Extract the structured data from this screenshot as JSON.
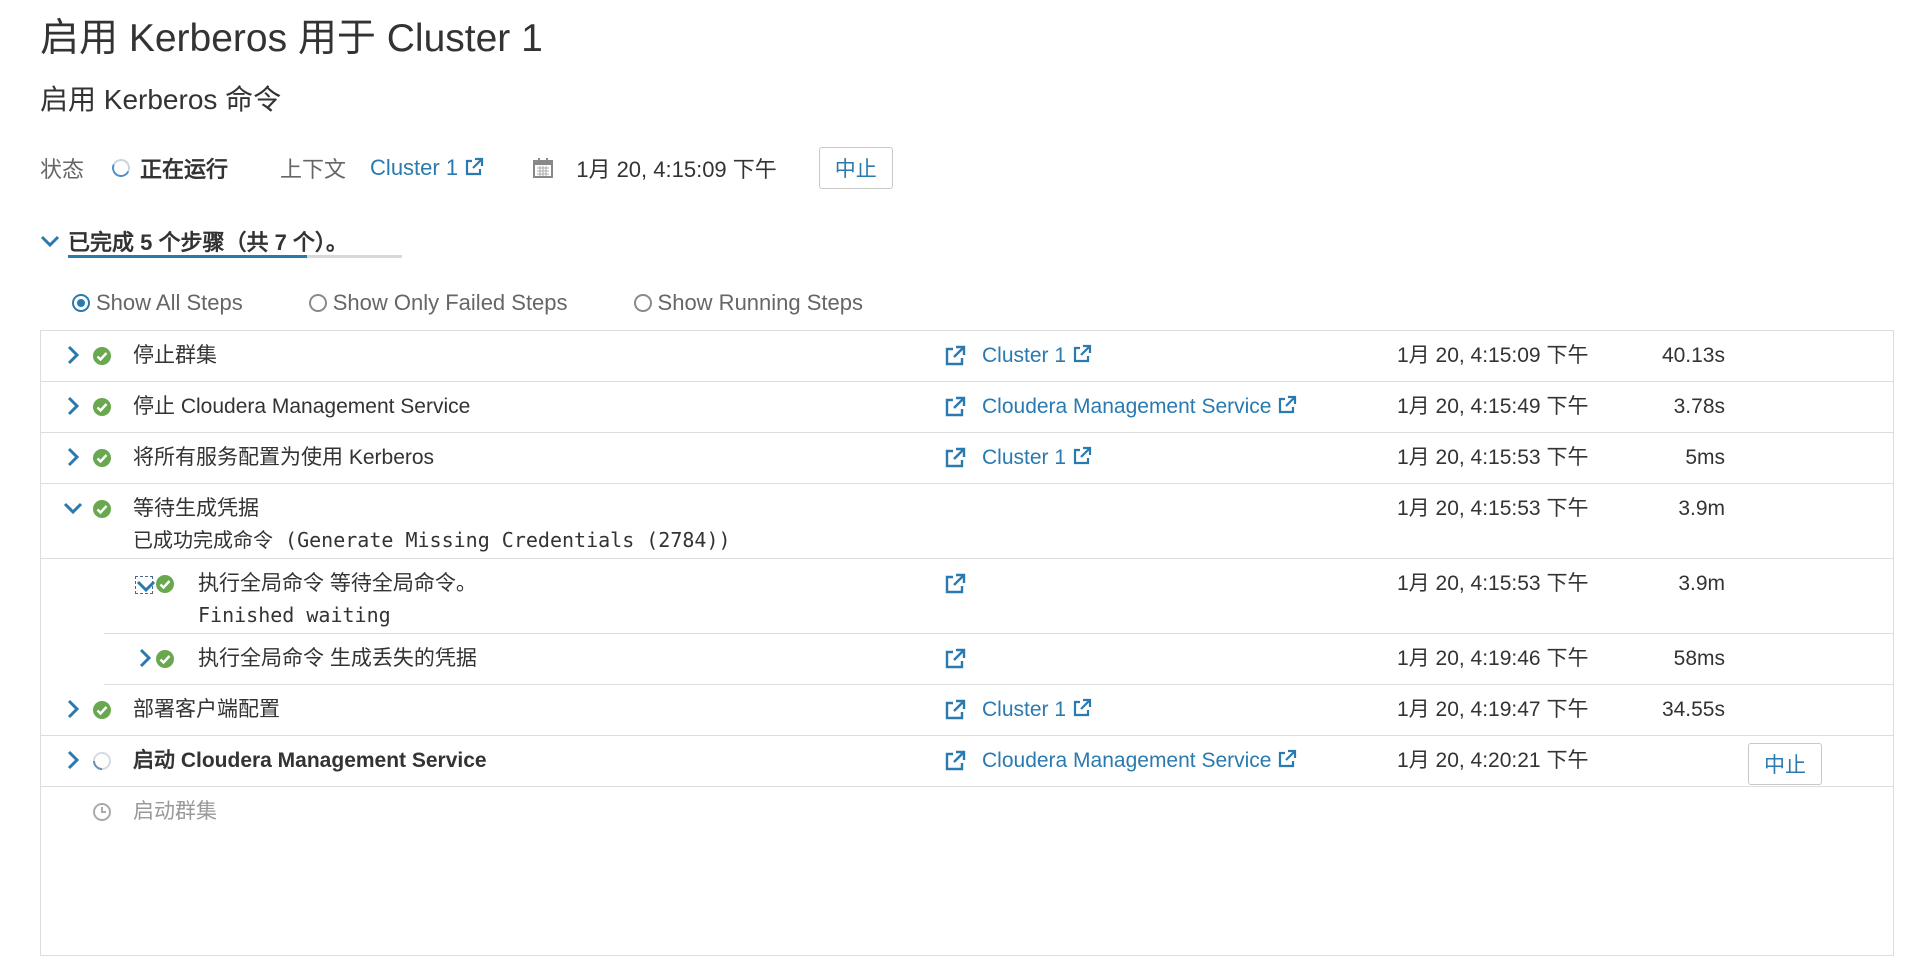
{
  "page": {
    "title": "启用 Kerberos 用于 Cluster 1",
    "command_title": "启用 Kerberos 命令"
  },
  "status_bar": {
    "status_label": "状态",
    "status_value": "正在运行",
    "context_label": "上下文",
    "context_link": "Cluster 1",
    "start_time": "1月 20, 4:15:09 下午",
    "abort_label": "中止"
  },
  "progress": {
    "text": "已完成 5 个步骤（共 7 个）。",
    "completed": 5,
    "total": 7
  },
  "filters": {
    "selected": "all",
    "options": [
      {
        "id": "all",
        "label": "Show All Steps"
      },
      {
        "id": "failed",
        "label": "Show Only Failed Steps"
      },
      {
        "id": "running",
        "label": "Show Running Steps"
      }
    ]
  },
  "steps": [
    {
      "name": "停止群集",
      "context": "Cluster 1",
      "time": "1月 20, 4:15:09 下午",
      "duration": "40.13s",
      "status": "success",
      "expanded": false
    },
    {
      "name": "停止 Cloudera Management Service",
      "context": "Cloudera Management Service",
      "time": "1月 20, 4:15:49 下午",
      "duration": "3.78s",
      "status": "success",
      "expanded": false
    },
    {
      "name": "将所有服务配置为使用 Kerberos",
      "context": "Cluster 1",
      "time": "1月 20, 4:15:53 下午",
      "duration": "5ms",
      "status": "success",
      "expanded": false
    },
    {
      "name": "等待生成凭据",
      "detail": "已成功完成命令 (Generate Missing Credentials (2784))",
      "time": "1月 20, 4:15:53 下午",
      "duration": "3.9m",
      "status": "success",
      "expanded": true
    },
    {
      "name": "执行全局命令 等待全局命令。",
      "detail": "Finished waiting",
      "time": "1月 20, 4:15:53 下午",
      "duration": "3.9m",
      "status": "success",
      "expanded": true,
      "sub": true
    },
    {
      "name": "执行全局命令 生成丢失的凭据",
      "time": "1月 20, 4:19:46 下午",
      "duration": "58ms",
      "status": "success",
      "expanded": false,
      "sub": true
    },
    {
      "name": "部署客户端配置",
      "context": "Cluster 1",
      "time": "1月 20, 4:19:47 下午",
      "duration": "34.55s",
      "status": "success",
      "expanded": false
    },
    {
      "name": "启动 Cloudera Management Service",
      "context": "Cloudera Management Service",
      "time": "1月 20, 4:20:21 下午",
      "status": "running",
      "expanded": false,
      "abort_label": "中止"
    },
    {
      "name": "启动群集",
      "status": "pending"
    }
  ],
  "colors": {
    "link": "#2a7ab0",
    "success": "#6aa84f",
    "chevron": "#2a7ab0",
    "border": "#dddddd"
  }
}
